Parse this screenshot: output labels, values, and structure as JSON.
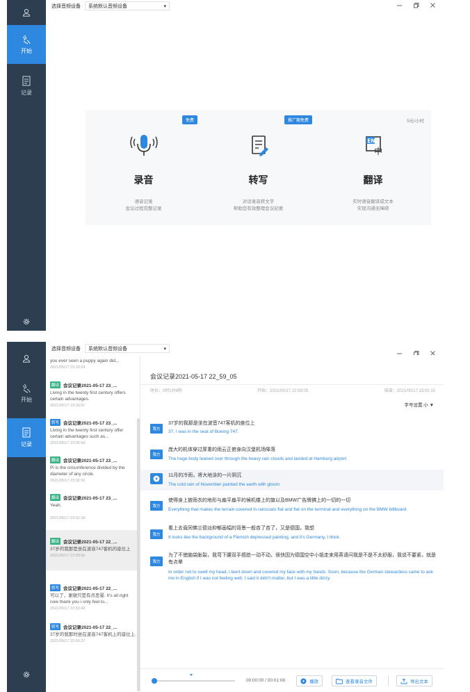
{
  "colors": {
    "sidebar": "#2d3e50",
    "accent": "#2e88e0",
    "tag_green": "#3ab387"
  },
  "topbar": {
    "device_label": "选择音频设备",
    "device_value": "系统默认音频设备"
  },
  "sidebar": {
    "items": [
      {
        "label": "开始",
        "icon": "microphone-hand-icon"
      },
      {
        "label": "记录",
        "icon": "document-icon"
      }
    ]
  },
  "cards": [
    {
      "badge": "免费",
      "title": "录音",
      "desc1": "语音记录",
      "desc2": "会议过程完整记录",
      "icon": "microphone-icon"
    },
    {
      "badge": "推广期免费",
      "title": "转写",
      "desc1": "对话录音转文字",
      "desc2": "帮助您有效整理会议纪要",
      "icon": "edit-document-icon"
    },
    {
      "price": "5元/小时",
      "title": "翻译",
      "desc1": "实时语音翻译成文本",
      "desc2": "实现沟通无障碍",
      "icon": "en-zh-translate-icon"
    }
  ],
  "list": {
    "top_fragment": {
      "body": "you ever seen a puppy again did...",
      "time": "2021/05/17 23:10:24"
    },
    "items": [
      {
        "tag": "翻译",
        "title": "会议记录2021-05-17 23_...",
        "body": "Living in the twenty first century offers certain advantages.",
        "time": "2021/05/17 23:06:57"
      },
      {
        "tag": "转写",
        "title": "会议记录2021-05-17 23_...",
        "body": "Living in the twenty first century offer certain advantages such as...",
        "time": "2021/05/17 23:05:54"
      },
      {
        "tag": "翻译",
        "title": "会议记录2021-05-17 23_...",
        "body": "Pi is the circumference divided by the diameter of any circle.",
        "time": "2021/05/17 23:02:56"
      },
      {
        "tag": "翻译",
        "title": "会议记录2021-05-17 23_...",
        "body": "Yeah.",
        "time": "2021/05/17 23:01:18"
      },
      {
        "tag": "翻译",
        "title": "会议记录2021-05-17 22_...",
        "body": "37岁的我那是坐在波音747客机的座位上",
        "time": "2021/05/17 22:59:05"
      },
      {
        "tag": "转写",
        "title": "会议记录2021-05-17 22_...",
        "body": "可以了，谢谢只是有点恶晕. It's all right now thank you i only feel lo...",
        "time": "2021/05/17 22:53:43"
      },
      {
        "tag": "转写",
        "title": "会议记录2021-05-17 22_...",
        "body": "37岁的我那时坐在波音747客机上的座位上.",
        "time": "2021/05/17 22:50:37"
      }
    ]
  },
  "detail": {
    "title": "会议记录2021-05-17 22_59_05",
    "duration": "时长：0时1分8秒",
    "start": "开始：2021/05/17 22:59:05",
    "end": "结束：2021/05/17 23:00:15",
    "font_setting": "字号设置:小 ▼",
    "speaker": "我方",
    "messages": [
      {
        "zh": "37岁的我那是坐在波音747客机的座位上",
        "en": "37, I was in the seat of Boeing 747."
      },
      {
        "zh": "庞大的机体穿过厚重的雨云正俯身向汉堡机场降落",
        "en": "The huge body leaned over through the heavy rain clouds and landed at Hamburg airport"
      },
      {
        "zh": "11月的冷雨，将大地涂的一片阴沉",
        "en": "The cold rain of November painted the earth with gloom"
      },
      {
        "zh": "使得身上披雨衣的地形与扁平扁平的候机楼上的旗以及BMW广告牌拂上的一切的一切",
        "en": "Everything that makes the terrain covered in raincoats flat and flat on the terminal and everything on the BMW billboard."
      },
      {
        "zh": "看上去竟同佛兰德派抑郁画幅的背景一般吝了吝了，又是德国，我想",
        "en": "It looks like the background of a Flemish depressed painting, and it's Germany, I think."
      },
      {
        "zh": "为了不使脑袋胀裂，我弯下腰双手捂脸一动不动，很快因为德国空中小姐走来用英语问我是不是不太舒服，我说不要紧，就是有点晕",
        "en": "In order not to swell my head, I bent down and covered my face with my hands. Soon, because the German stewardess came to ask me in English if I was not feeling well, I said it didn't matter, but I was a little dizzy."
      }
    ]
  },
  "player": {
    "time": "00:00:00 / 00:01:08",
    "play_label": "播放",
    "open_file_label": "查看录音文件",
    "export_label": "导出文本"
  }
}
